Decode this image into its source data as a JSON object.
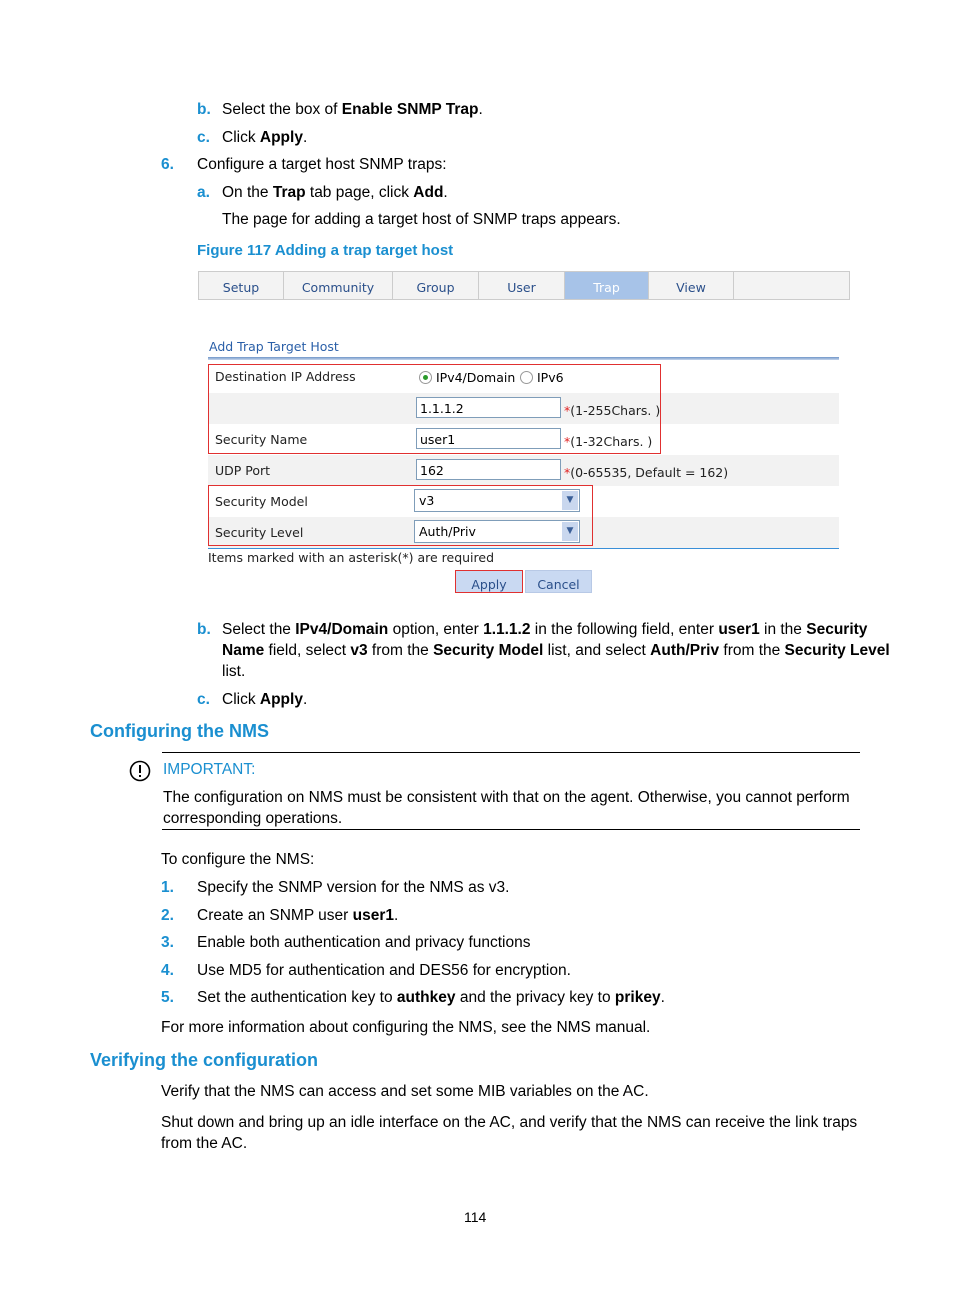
{
  "steps_top": [
    {
      "marker": "b.",
      "parts": [
        "Select the box of ",
        "Enable SNMP Trap",
        "."
      ]
    },
    {
      "marker": "c.",
      "parts": [
        "Click ",
        "Apply",
        "."
      ]
    }
  ],
  "step6": {
    "marker": "6.",
    "text": "Configure a target host SNMP traps:"
  },
  "step6a": {
    "marker": "a.",
    "parts": [
      "On the ",
      "Trap",
      " tab page, click ",
      "Add",
      "."
    ],
    "follow": "The page for adding a target host of SNMP traps appears."
  },
  "figure_caption": "Figure 117 Adding a trap target host",
  "screenshot": {
    "tabs": [
      {
        "label": "Setup"
      },
      {
        "label": "Community"
      },
      {
        "label": "Group"
      },
      {
        "label": "User"
      },
      {
        "label": "Trap",
        "active": true
      },
      {
        "label": "View"
      }
    ],
    "section_title": "Add Trap Target Host",
    "dest_label": "Destination IP Address",
    "radio_ipv4": "IPv4/Domain",
    "radio_ipv6": "IPv6",
    "selected": "IPv4/Domain",
    "ip_value": "1.1.1.2",
    "ip_hint": "(1-255Chars. )",
    "secname_label": "Security Name",
    "secname_value": "user1",
    "secname_hint": "(1-32Chars. )",
    "udp_label": "UDP Port",
    "udp_value": "162",
    "udp_hint": "(0-65535, Default = 162)",
    "secmodel_label": "Security Model",
    "secmodel_value": "v3",
    "seclevel_label": "Security Level",
    "seclevel_value": "Auth/Priv",
    "asterisk": "*",
    "required_note": "Items marked with an asterisk(*) are required",
    "apply": "Apply",
    "cancel": "Cancel",
    "highlight_color": "#e03030"
  },
  "step_b": {
    "marker": "b.",
    "line1": [
      "Select the ",
      "IPv4/Domain",
      " option, enter ",
      "1.1.1.2",
      " in the following field, enter ",
      "user1",
      " in the ",
      "Security"
    ],
    "line2": [
      "Name",
      " field, select ",
      "v3",
      " from the ",
      "Security Model",
      " list, and select ",
      "Auth/Priv",
      " from the ",
      "Security Level"
    ],
    "line3": "list."
  },
  "step_c": {
    "marker": "c.",
    "parts": [
      "Click ",
      "Apply",
      "."
    ]
  },
  "heading_nms": "Configuring the NMS",
  "important": {
    "label": "IMPORTANT:",
    "line1": "The configuration on NMS must be consistent with that on the agent. Otherwise, you cannot perform",
    "line2": "corresponding operations."
  },
  "nms_intro": "To configure the NMS:",
  "nms_steps": [
    {
      "marker": "1.",
      "parts": [
        "Specify the SNMP version for the NMS as v3.",
        "",
        ""
      ]
    },
    {
      "marker": "2.",
      "parts": [
        "Create an SNMP user ",
        "user1",
        "."
      ]
    },
    {
      "marker": "3.",
      "parts": [
        "Enable both authentication and privacy functions",
        "",
        ""
      ]
    },
    {
      "marker": "4.",
      "parts": [
        "Use MD5 for authentication and DES56 for encryption.",
        "",
        ""
      ]
    },
    {
      "marker": "5.",
      "parts": [
        "Set the authentication key to ",
        "authkey",
        " and the privacy key to ",
        "prikey",
        "."
      ]
    }
  ],
  "nms_more": "For more information about configuring the NMS, see the NMS manual.",
  "heading_verify": "Verifying the configuration",
  "verify1": "Verify that the NMS can access and set some MIB variables on the AC.",
  "verify2a": "Shut down and bring up an idle interface on the AC, and verify that the NMS can receive the link traps",
  "verify2b": "from the AC.",
  "page_number": "114",
  "accent_color": "#1a8fd0"
}
